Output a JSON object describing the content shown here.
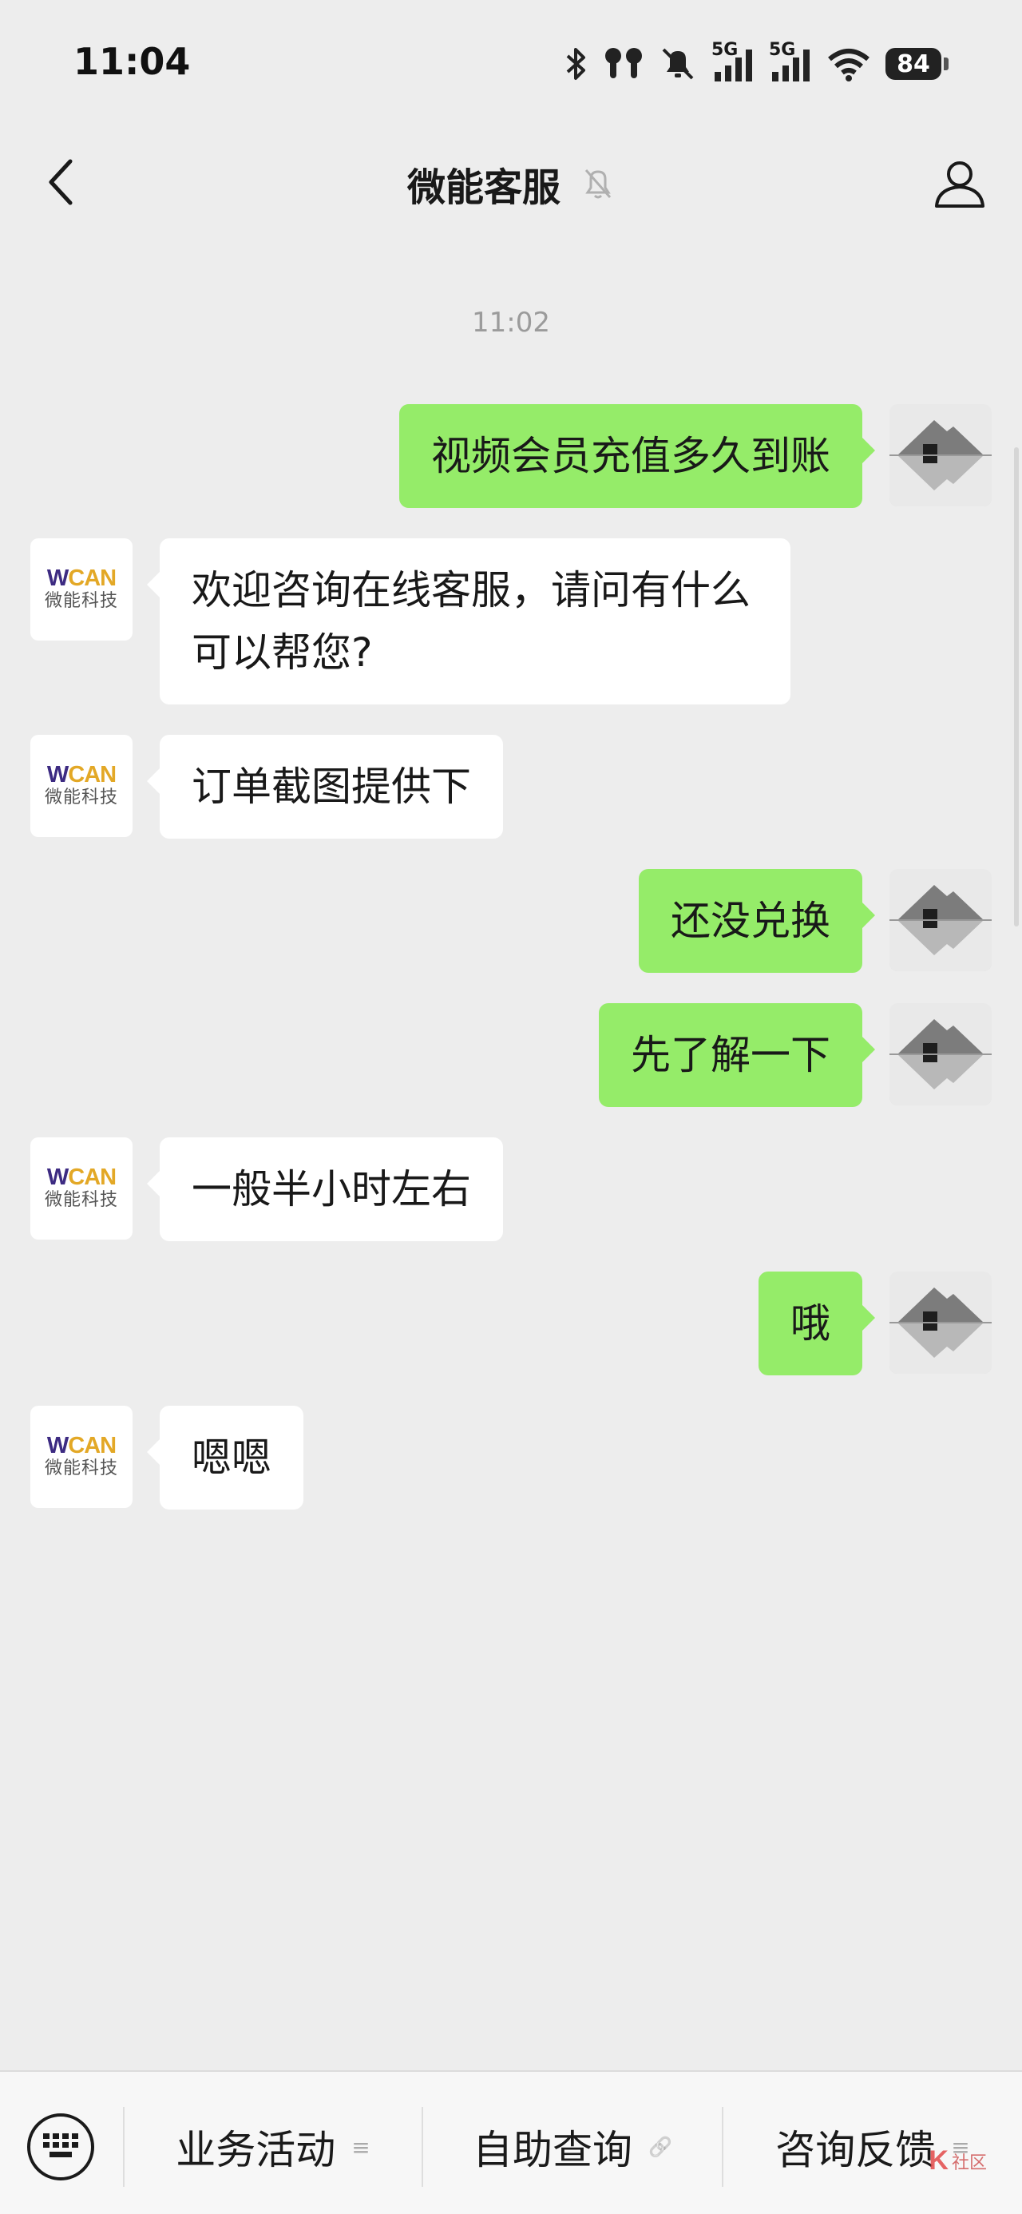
{
  "status_bar": {
    "time": "11:04",
    "network_1": "5G",
    "network_2": "5G",
    "battery": "84",
    "icons": [
      "bluetooth-icon",
      "earbuds-icon",
      "mute-bell-icon",
      "signal-5g-icon",
      "signal-5g-icon",
      "wifi-icon",
      "battery-icon"
    ]
  },
  "nav": {
    "title": "微能客服",
    "icons": [
      "back-arrow-icon",
      "mute-icon",
      "profile-icon"
    ]
  },
  "chat": {
    "timestamp": "11:02",
    "messages": [
      {
        "side": "right",
        "text": "视频会员充值多久到账"
      },
      {
        "side": "left",
        "text": "欢迎咨询在线客服，请问有什么可以帮您?"
      },
      {
        "side": "left",
        "text": "订单截图提供下"
      },
      {
        "side": "right",
        "text": "还没兑换"
      },
      {
        "side": "right",
        "text": "先了解一下"
      },
      {
        "side": "left",
        "text": "一般半小时左右"
      },
      {
        "side": "right",
        "text": "哦"
      },
      {
        "side": "left",
        "text": "嗯嗯"
      }
    ],
    "agent_avatar": {
      "logo_w": "W",
      "logo_can": "CAN",
      "logo_cn": "微能科技"
    }
  },
  "bottom_menu": {
    "items": [
      {
        "label": "业务活动",
        "suffix": "≡"
      },
      {
        "label": "自助查询",
        "suffix": "🔗"
      },
      {
        "label": "咨询反馈",
        "suffix": "≡"
      }
    ],
    "watermark_k": "K",
    "watermark_text": "社区"
  },
  "colors": {
    "background": "#ededed",
    "sent_bubble": "#95ec69",
    "received_bubble": "#ffffff"
  }
}
